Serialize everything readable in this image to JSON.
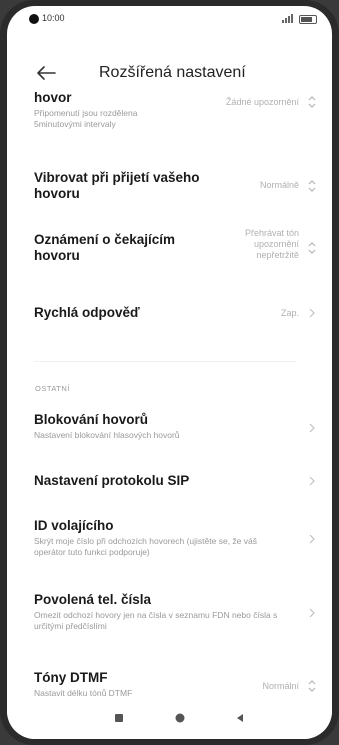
{
  "status_bar": {
    "time": "10:00"
  },
  "header": {
    "title": "Rozšířená nastavení"
  },
  "rows": [
    {
      "title": "hovor",
      "subtitle": "Připomenutí jsou rozdělena 5minutovými intervaly",
      "value": "Žádné upozornění",
      "icon": "updown-icon"
    },
    {
      "title": "Vibrovat při přijetí vašeho hovoru",
      "subtitle": "",
      "value": "Normálně",
      "icon": "updown-icon"
    },
    {
      "title": "Oznámení o čekajícím hovoru",
      "subtitle": "",
      "value": "Přehrávat tón upozornění nepřetržitě",
      "icon": "updown-icon"
    },
    {
      "title": "Rychlá odpověď",
      "subtitle": "",
      "value": "Zap.",
      "icon": "chevron-right-icon"
    }
  ],
  "section": {
    "label": "OSTATNÍ"
  },
  "other_rows": [
    {
      "title": "Blokování hovorů",
      "subtitle": "Nastavení blokování hlasových hovorů",
      "value": "",
      "icon": "chevron-right-icon"
    },
    {
      "title": "Nastavení protokolu SIP",
      "subtitle": "",
      "value": "",
      "icon": "chevron-right-icon"
    },
    {
      "title": "ID volajícího",
      "subtitle": "Skrýt moje číslo při odchozích hovorech (ujistěte se, že váš operátor tuto funkci podporuje)",
      "value": "",
      "icon": "chevron-right-icon"
    },
    {
      "title": "Povolená tel. čísla",
      "subtitle": "Omezit odchozí hovory jen na čísla v seznamu FDN nebo čísla s určitými předčíslími",
      "value": "",
      "icon": "chevron-right-icon"
    },
    {
      "title": "Tóny DTMF",
      "subtitle": "Nastavit délku tónů DTMF",
      "value": "Normální",
      "icon": "updown-icon"
    }
  ],
  "nav": {
    "icons": [
      "recents-icon",
      "home-icon",
      "back-icon"
    ]
  }
}
